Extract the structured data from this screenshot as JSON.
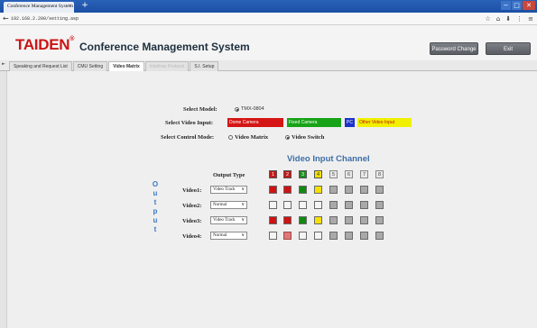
{
  "browser": {
    "tab_title": "Conference Management System",
    "tab_close": "×",
    "new_tab": "+",
    "url": "192.168.2.200/setting.asp",
    "nav_back": "←",
    "min": "−",
    "max": "□",
    "close": "✕",
    "nav_icons": [
      "☆",
      "⌂",
      "⬇",
      "⋮",
      "≡"
    ]
  },
  "header": {
    "logo": "TAIDEN",
    "logo_mark": "®",
    "title": "Conference Management System",
    "password_button": "Password Change",
    "exit_button": "Exit"
  },
  "tabs": [
    {
      "label": "Speaking and Request List",
      "state": "normal"
    },
    {
      "label": "CMU Setting",
      "state": "normal"
    },
    {
      "label": "Video Matrix",
      "state": "active"
    },
    {
      "label": "Intelitrax Protocol",
      "state": "disabled"
    },
    {
      "label": "S.I. Setup",
      "state": "normal"
    }
  ],
  "side_arrow": "►",
  "form": {
    "select_model_label": "Select Model:",
    "select_model_value": "TMX-0804",
    "select_input_label": "Select Video Input:",
    "video_inputs": [
      {
        "label": "Dome Camera",
        "color": "red"
      },
      {
        "label": "Fixed Camera",
        "color": "green"
      },
      {
        "label": "PC",
        "color": "blue"
      },
      {
        "label": "Other Video Input",
        "color": "yellow"
      }
    ],
    "control_mode_label": "Select Control Mode:",
    "control_modes": [
      {
        "label": "Video Matrix",
        "selected": false
      },
      {
        "label": "Video Switch",
        "selected": true
      }
    ]
  },
  "matrix": {
    "channel_title": "Video Input Channel",
    "output_type_label": "Output Type",
    "output_letters": [
      "O",
      "u",
      "t",
      "p",
      "u",
      "t"
    ],
    "channels": [
      {
        "num": "1",
        "color": "red"
      },
      {
        "num": "2",
        "color": "red"
      },
      {
        "num": "3",
        "color": "green"
      },
      {
        "num": "4",
        "color": "yellow"
      },
      {
        "num": "5",
        "color": "gray"
      },
      {
        "num": "6",
        "color": "gray"
      },
      {
        "num": "7",
        "color": "gray"
      },
      {
        "num": "8",
        "color": "gray"
      }
    ],
    "select_arrow": "∨",
    "rows": [
      {
        "label": "Video1:",
        "type": "Video Track",
        "cells": [
          "red",
          "red",
          "green",
          "yellow",
          "gray",
          "gray",
          "gray",
          "gray"
        ]
      },
      {
        "label": "Video2:",
        "type": "Normal",
        "cells": [
          "white",
          "white",
          "white",
          "white",
          "gray",
          "gray",
          "gray",
          "gray"
        ]
      },
      {
        "label": "Video3:",
        "type": "Video Track",
        "cells": [
          "red",
          "red",
          "green",
          "yellow",
          "gray",
          "gray",
          "gray",
          "gray"
        ]
      },
      {
        "label": "Video4:",
        "type": "Normal",
        "cells": [
          "white",
          "red-light",
          "white",
          "white",
          "gray",
          "gray",
          "gray",
          "gray"
        ]
      }
    ]
  }
}
